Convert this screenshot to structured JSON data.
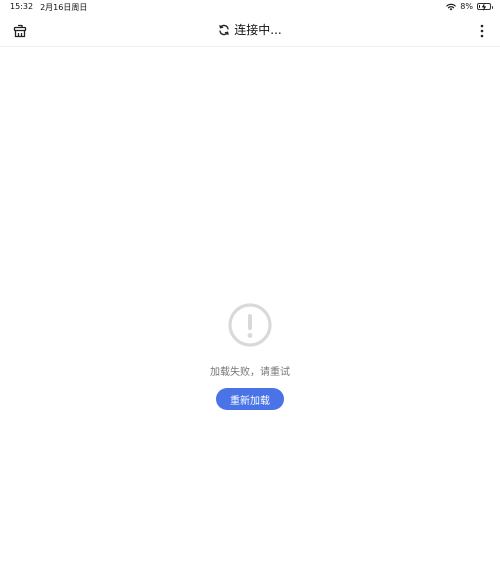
{
  "status_bar": {
    "time": "15:32",
    "date": "2月16日周日",
    "battery": "8%",
    "battery_level": 0.08,
    "wifi_icon": "wifi-icon",
    "battery_icon": "battery-charging-icon"
  },
  "top_bar": {
    "title": "连接中...",
    "left_icon": "clean-bucket-icon",
    "title_icon": "refresh-icon",
    "right_icon": "more-vertical-icon"
  },
  "error": {
    "icon": "exclamation-circle-icon",
    "message": "加载失败，请重试",
    "reload_label": "重新加载"
  },
  "colors": {
    "accent": "#4a73e8",
    "icon_gray": "#d9d9d9",
    "message_gray": "#777777"
  }
}
